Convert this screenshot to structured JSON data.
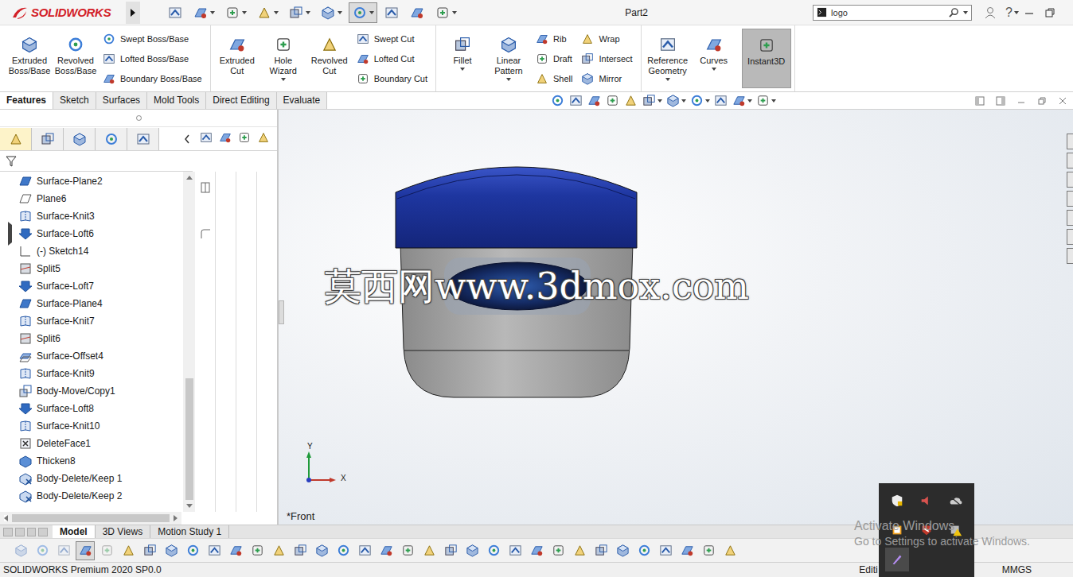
{
  "window": {
    "title": "Part2"
  },
  "app": {
    "logo_text": "SOLIDWORKS",
    "help": "?"
  },
  "quick_access": [
    {
      "selected": false,
      "menu": false
    },
    {
      "selected": false,
      "menu": true
    },
    {
      "selected": false,
      "menu": true
    },
    {
      "selected": false,
      "menu": true
    },
    {
      "selected": false,
      "menu": true
    },
    {
      "selected": false,
      "menu": true
    },
    {
      "selected": true,
      "menu": true
    },
    {
      "selected": false,
      "menu": false
    },
    {
      "selected": false,
      "menu": false
    },
    {
      "selected": false,
      "menu": true
    }
  ],
  "search": {
    "value": "logo"
  },
  "ribbon": [
    {
      "large": [
        {
          "label": "Extruded Boss/Base",
          "menu": false,
          "selected": false
        },
        {
          "label": "Revolved Boss/Base",
          "menu": false,
          "selected": false
        }
      ],
      "columns": [
        [
          "Swept Boss/Base",
          "Lofted Boss/Base",
          "Boundary Boss/Base"
        ]
      ]
    },
    {
      "large": [
        {
          "label": "Extruded Cut",
          "menu": false,
          "selected": false
        },
        {
          "label": "Hole Wizard",
          "menu": true,
          "selected": false
        },
        {
          "label": "Revolved Cut",
          "menu": false,
          "selected": false
        }
      ],
      "columns": [
        [
          "Swept Cut",
          "Lofted Cut",
          "Boundary Cut"
        ]
      ]
    },
    {
      "large": [
        {
          "label": "Fillet",
          "menu": true,
          "selected": false
        },
        {
          "label": "Linear Pattern",
          "menu": true,
          "selected": false
        }
      ],
      "columns": [
        [
          "Rib",
          "Draft",
          "Shell"
        ],
        [
          "Wrap",
          "Intersect",
          "Mirror"
        ]
      ]
    },
    {
      "large": [
        {
          "label": "Reference Geometry",
          "menu": true,
          "selected": false
        },
        {
          "label": "Curves",
          "menu": true,
          "selected": false
        },
        {
          "label": "Instant3D",
          "menu": false,
          "selected": true
        }
      ],
      "columns": []
    }
  ],
  "feature_tabs": [
    {
      "label": "Features",
      "selected": true
    },
    {
      "label": "Sketch",
      "selected": false
    },
    {
      "label": "Surfaces",
      "selected": false
    },
    {
      "label": "Mold Tools",
      "selected": false
    },
    {
      "label": "Direct Editing",
      "selected": false
    },
    {
      "label": "Evaluate",
      "selected": false
    }
  ],
  "heads_up": [
    {
      "menu": false
    },
    {
      "menu": false
    },
    {
      "menu": false
    },
    {
      "menu": false
    },
    {
      "menu": false
    },
    {
      "menu": true
    },
    {
      "menu": true
    },
    {
      "menu": true
    },
    {
      "menu": false
    },
    {
      "menu": true
    },
    {
      "menu": true
    }
  ],
  "panel_tabs": [
    {
      "selected": true
    },
    {
      "selected": false
    },
    {
      "selected": false
    },
    {
      "selected": false
    },
    {
      "selected": false
    }
  ],
  "tree": [
    {
      "label": "Surface-Plane2",
      "kind": "surface-plane",
      "expandable": false,
      "expanded": false
    },
    {
      "label": "Plane6",
      "kind": "plane",
      "expandable": false,
      "expanded": false
    },
    {
      "label": "Surface-Knit3",
      "kind": "knit",
      "expandable": false,
      "expanded": false
    },
    {
      "label": "Surface-Loft6",
      "kind": "loft",
      "expandable": true,
      "expanded": false
    },
    {
      "label": "(-) Sketch14",
      "kind": "sketch",
      "expandable": false,
      "expanded": false
    },
    {
      "label": "Split5",
      "kind": "split",
      "expandable": false,
      "expanded": false
    },
    {
      "label": "Surface-Loft7",
      "kind": "loft",
      "expandable": false,
      "expanded": false
    },
    {
      "label": "Surface-Plane4",
      "kind": "surface-plane",
      "expandable": false,
      "expanded": false
    },
    {
      "label": "Surface-Knit7",
      "kind": "knit",
      "expandable": false,
      "expanded": false
    },
    {
      "label": "Split6",
      "kind": "split",
      "expandable": false,
      "expanded": false
    },
    {
      "label": "Surface-Offset4",
      "kind": "offset",
      "expandable": false,
      "expanded": false
    },
    {
      "label": "Surface-Knit9",
      "kind": "knit",
      "expandable": false,
      "expanded": false
    },
    {
      "label": "Body-Move/Copy1",
      "kind": "move",
      "expandable": false,
      "expanded": false
    },
    {
      "label": "Surface-Loft8",
      "kind": "loft",
      "expandable": false,
      "expanded": false
    },
    {
      "label": "Surface-Knit10",
      "kind": "knit",
      "expandable": false,
      "expanded": false
    },
    {
      "label": "DeleteFace1",
      "kind": "delete-face",
      "expandable": false,
      "expanded": false
    },
    {
      "label": "Thicken8",
      "kind": "thicken",
      "expandable": false,
      "expanded": false
    },
    {
      "label": "Body-Delete/Keep 1",
      "kind": "body-delete",
      "expandable": false,
      "expanded": false
    },
    {
      "label": "Body-Delete/Keep 2",
      "kind": "body-delete",
      "expandable": false,
      "expanded": false
    }
  ],
  "viewport": {
    "view_name": "*Front",
    "triad": {
      "y": "Y",
      "x": "X"
    },
    "watermark": "莫西网www.3dmox.com"
  },
  "model_tabs": [
    {
      "label": "Model",
      "selected": true
    },
    {
      "label": "3D Views",
      "selected": false
    },
    {
      "label": "Motion Study 1",
      "selected": false
    }
  ],
  "bottom_toolbar": [
    {
      "selected": false,
      "disabled": true
    },
    {
      "selected": false,
      "disabled": true
    },
    {
      "selected": false,
      "disabled": true
    },
    {
      "selected": true,
      "disabled": false
    },
    {
      "selected": false,
      "disabled": true
    },
    {
      "selected": false,
      "disabled": false
    },
    {
      "selected": false,
      "disabled": false
    },
    {
      "selected": false,
      "disabled": false
    },
    {
      "selected": false,
      "disabled": false
    },
    {
      "selected": false,
      "disabled": false
    },
    {
      "selected": false,
      "disabled": false
    },
    {
      "selected": false,
      "disabled": false
    },
    {
      "selected": false,
      "disabled": false
    },
    {
      "selected": false,
      "disabled": false
    },
    {
      "selected": false,
      "disabled": false
    },
    {
      "selected": false,
      "disabled": false
    },
    {
      "selected": false,
      "disabled": false
    },
    {
      "selected": false,
      "disabled": false
    },
    {
      "selected": false,
      "disabled": false
    },
    {
      "selected": false,
      "disabled": false
    },
    {
      "selected": false,
      "disabled": false
    },
    {
      "selected": false,
      "disabled": false
    },
    {
      "selected": false,
      "disabled": false
    },
    {
      "selected": false,
      "disabled": false
    },
    {
      "selected": false,
      "disabled": false
    },
    {
      "selected": false,
      "disabled": false
    },
    {
      "selected": false,
      "disabled": false
    },
    {
      "selected": false,
      "disabled": false
    },
    {
      "selected": false,
      "disabled": false
    },
    {
      "selected": false,
      "disabled": false
    },
    {
      "selected": false,
      "disabled": false
    },
    {
      "selected": false,
      "disabled": false
    },
    {
      "selected": false,
      "disabled": false
    },
    {
      "selected": false,
      "disabled": false
    }
  ],
  "status_bar": {
    "product": "SOLIDWORKS Premium 2020 SP0.0",
    "mode": "Editi",
    "units": "MMGS"
  },
  "activation": {
    "title": "Activate Windows",
    "subtitle": "Go to Settings to activate Windows."
  }
}
